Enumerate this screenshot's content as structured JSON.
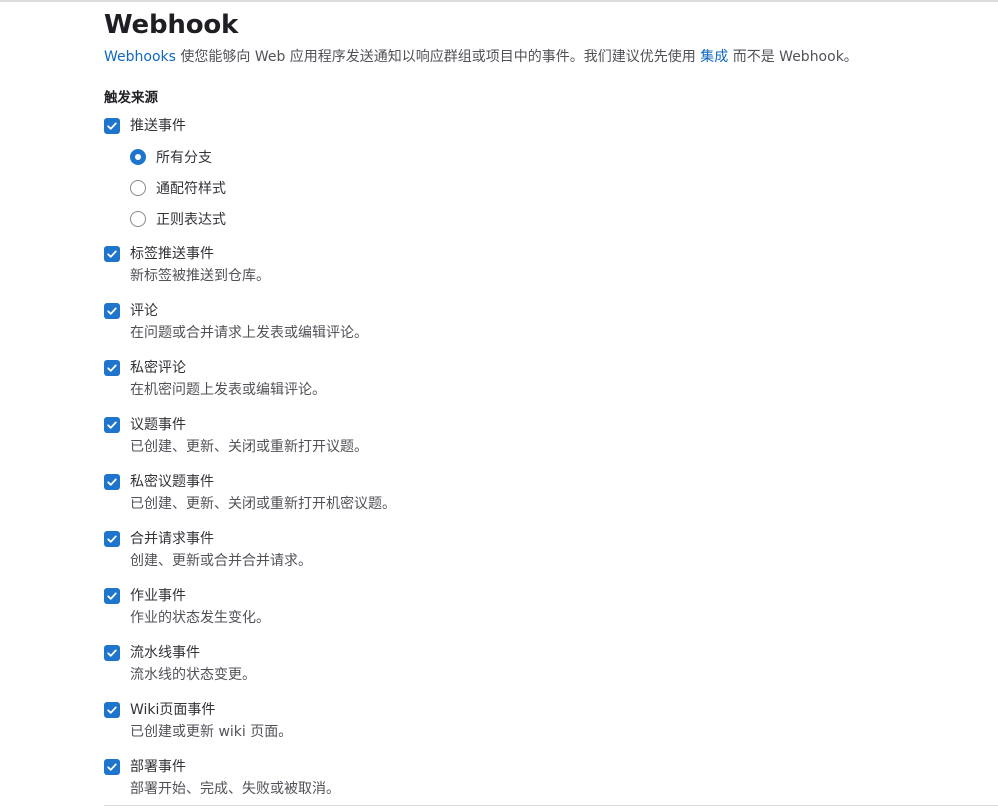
{
  "header": {
    "title": "Webhook"
  },
  "intro": {
    "link_webhooks": "Webhooks",
    "text_1": " 使您能够向 Web 应用程序发送通知以响应群组或项目中的事件。我们建议优先使用 ",
    "link_integrations": "集成",
    "text_2": " 而不是 Webhook。"
  },
  "trigger_section": {
    "title": "触发来源"
  },
  "triggers": {
    "push": {
      "label": "推送事件",
      "checked": true,
      "branch_options": [
        {
          "label": "所有分支",
          "selected": true
        },
        {
          "label": "通配符样式",
          "selected": false
        },
        {
          "label": "正则表达式",
          "selected": false
        }
      ]
    },
    "tag_push": {
      "label": "标签推送事件",
      "help": "新标签被推送到仓库。",
      "checked": true
    },
    "comments": {
      "label": "评论",
      "help": "在问题或合并请求上发表或编辑评论。",
      "checked": true
    },
    "confidential_comments": {
      "label": "私密评论",
      "help": "在机密问题上发表或编辑评论。",
      "checked": true
    },
    "issues": {
      "label": "议题事件",
      "help": "已创建、更新、关闭或重新打开议题。",
      "checked": true
    },
    "confidential_issues": {
      "label": "私密议题事件",
      "help": "已创建、更新、关闭或重新打开机密议题。",
      "checked": true
    },
    "merge_requests": {
      "label": "合并请求事件",
      "help": "创建、更新或合并合并请求。",
      "checked": true
    },
    "jobs": {
      "label": "作业事件",
      "help": "作业的状态发生变化。",
      "checked": true
    },
    "pipelines": {
      "label": "流水线事件",
      "help": "流水线的状态变更。",
      "checked": true
    },
    "wiki": {
      "label": "Wiki页面事件",
      "help": "已创建或更新 wiki 页面。",
      "checked": true
    },
    "deployments": {
      "label": "部署事件",
      "help": "部署开始、完成、失败或被取消。",
      "checked": true
    }
  },
  "colors": {
    "accent": "#1f75cb",
    "link": "#1068bf",
    "text": "#333238",
    "muted": "#535158"
  },
  "icons": {
    "checkbox": "check-icon"
  }
}
